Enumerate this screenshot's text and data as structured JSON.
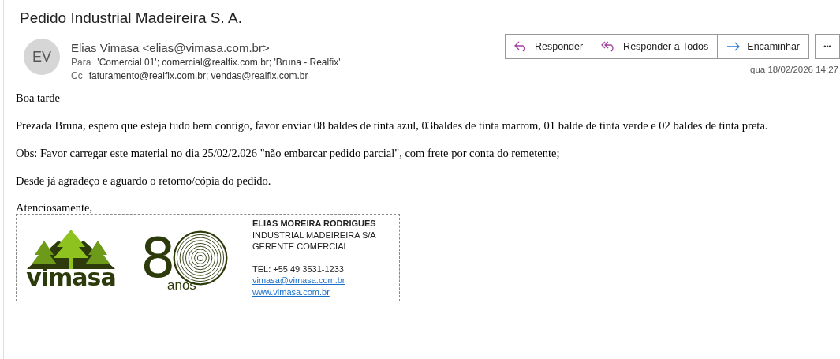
{
  "subject": "Pedido Industrial Madeireira S. A.",
  "sender": {
    "initials": "EV",
    "name": "Elias Vimasa <elias@vimasa.com.br>"
  },
  "to": {
    "label": "Para",
    "value": "'Comercial 01'; comercial@realfix.com.br; 'Bruna - Realfix'"
  },
  "cc": {
    "label": "Cc",
    "value": "faturamento@realfix.com.br; vendas@realfix.com.br"
  },
  "actions": [
    {
      "kind": "reply",
      "label": "Responder"
    },
    {
      "kind": "reply-all",
      "label": "Responder a Todos"
    },
    {
      "kind": "forward",
      "label": "Encaminhar"
    }
  ],
  "more": "•••",
  "date": "qua 18/02/2026 14:27",
  "body": [
    "Boa tarde",
    "Prezada Bruna, espero que esteja tudo bem contigo, favor enviar 08 baldes de tinta azul, 03baldes de tinta marrom, 01 balde de tinta verde e 02 baldes de tinta preta.",
    "Obs: Favor carregar este material no dia 25/02/2.026 \"não embarcar pedido parcial\", com frete por conta do remetente;",
    "Desde já agradeço e aguardo o retorno/cópia do pedido."
  ],
  "closing": "Atenciosamente,",
  "signature": {
    "brand": "vimasa",
    "anniversary_digit": "8",
    "anniversary_label": "anos",
    "lines": [
      {
        "kind": "name",
        "text": "ELIAS MOREIRA RODRIGUES"
      },
      {
        "kind": "plain",
        "text": "INDUSTRIAL MADEIREIRA S/A"
      },
      {
        "kind": "plain",
        "text": "GERENTE COMERCIAL"
      },
      {
        "kind": "gap",
        "text": "TEL: +55 49 3531-1233"
      },
      {
        "kind": "link",
        "text": "vimasa@vimasa.com.br"
      },
      {
        "kind": "link",
        "text": "www.vimasa.com.br"
      }
    ]
  }
}
